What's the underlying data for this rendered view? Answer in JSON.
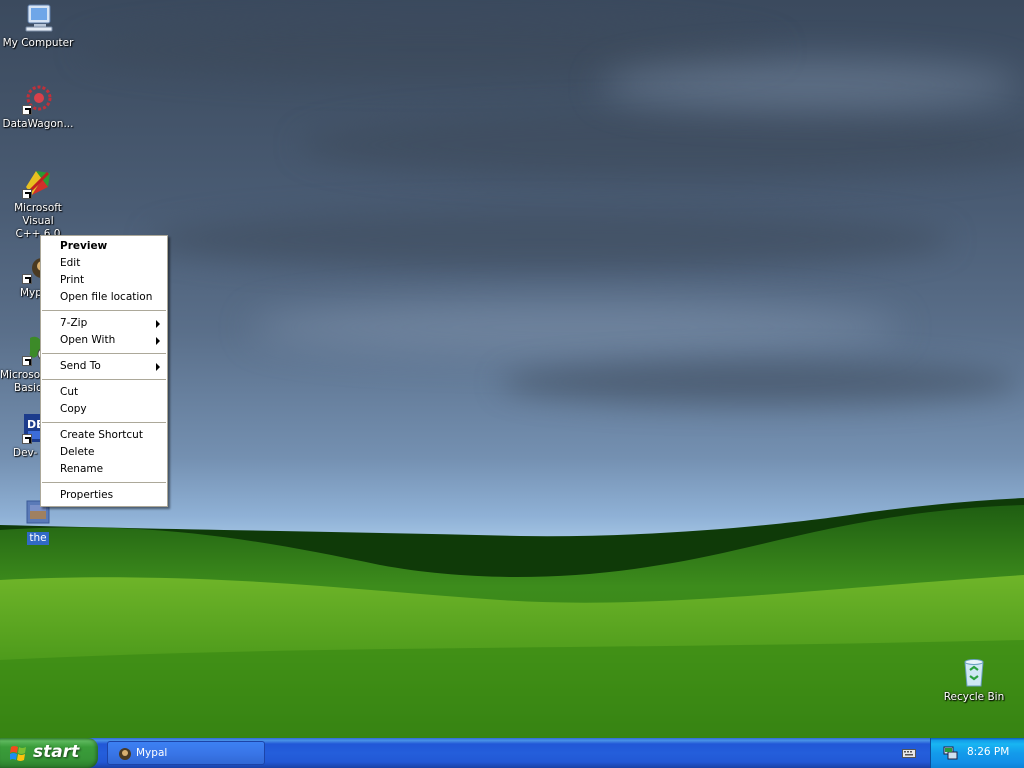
{
  "desktop": {
    "icons": [
      {
        "label_line1": "My Computer",
        "label_line2": "",
        "icon": "computer-icon"
      },
      {
        "label_line1": "DataWagon...",
        "label_line2": "",
        "icon": "datawagon-icon"
      },
      {
        "label_line1": "Microsoft Visual",
        "label_line2": "C++ 6.0",
        "icon": "visual-cpp-icon"
      },
      {
        "label_line1": "Myp",
        "label_line2": "",
        "icon": "mypal-icon"
      },
      {
        "label_line1": "Microsoft",
        "label_line2": "Basic",
        "icon": "visual-basic-icon"
      },
      {
        "label_line1": "Dev-",
        "label_line2": "",
        "icon": "dev-cpp-icon"
      },
      {
        "label_line1": "the",
        "label_line2": "",
        "icon": "image-file-icon",
        "selected": true
      }
    ],
    "recycle_bin": {
      "label": "Recycle Bin",
      "icon": "recycle-bin-icon"
    }
  },
  "context_menu": {
    "groups": [
      [
        {
          "label": "Preview",
          "bold": true,
          "submenu": false
        },
        {
          "label": "Edit",
          "bold": false,
          "submenu": false
        },
        {
          "label": "Print",
          "bold": false,
          "submenu": false
        },
        {
          "label": "Open file location",
          "bold": false,
          "submenu": false
        }
      ],
      [
        {
          "label": "7-Zip",
          "bold": false,
          "submenu": true
        },
        {
          "label": "Open With",
          "bold": false,
          "submenu": true
        }
      ],
      [
        {
          "label": "Send To",
          "bold": false,
          "submenu": true
        }
      ],
      [
        {
          "label": "Cut",
          "bold": false,
          "submenu": false
        },
        {
          "label": "Copy",
          "bold": false,
          "submenu": false
        }
      ],
      [
        {
          "label": "Create Shortcut",
          "bold": false,
          "submenu": false
        },
        {
          "label": "Delete",
          "bold": false,
          "submenu": false
        },
        {
          "label": "Rename",
          "bold": false,
          "submenu": false
        }
      ],
      [
        {
          "label": "Properties",
          "bold": false,
          "submenu": false
        }
      ]
    ]
  },
  "taskbar": {
    "start_label": "start",
    "tasks": [
      {
        "label": "Mypal",
        "icon": "mypal-icon"
      }
    ],
    "tray": {
      "time": "8:26 PM",
      "icons": [
        "keyboard-icon",
        "network-icon"
      ]
    }
  },
  "colors": {
    "taskbar_blue": "#245edb",
    "start_green": "#3a9d3a",
    "tray_blue": "#139beb",
    "selection_blue": "#316ac5"
  }
}
